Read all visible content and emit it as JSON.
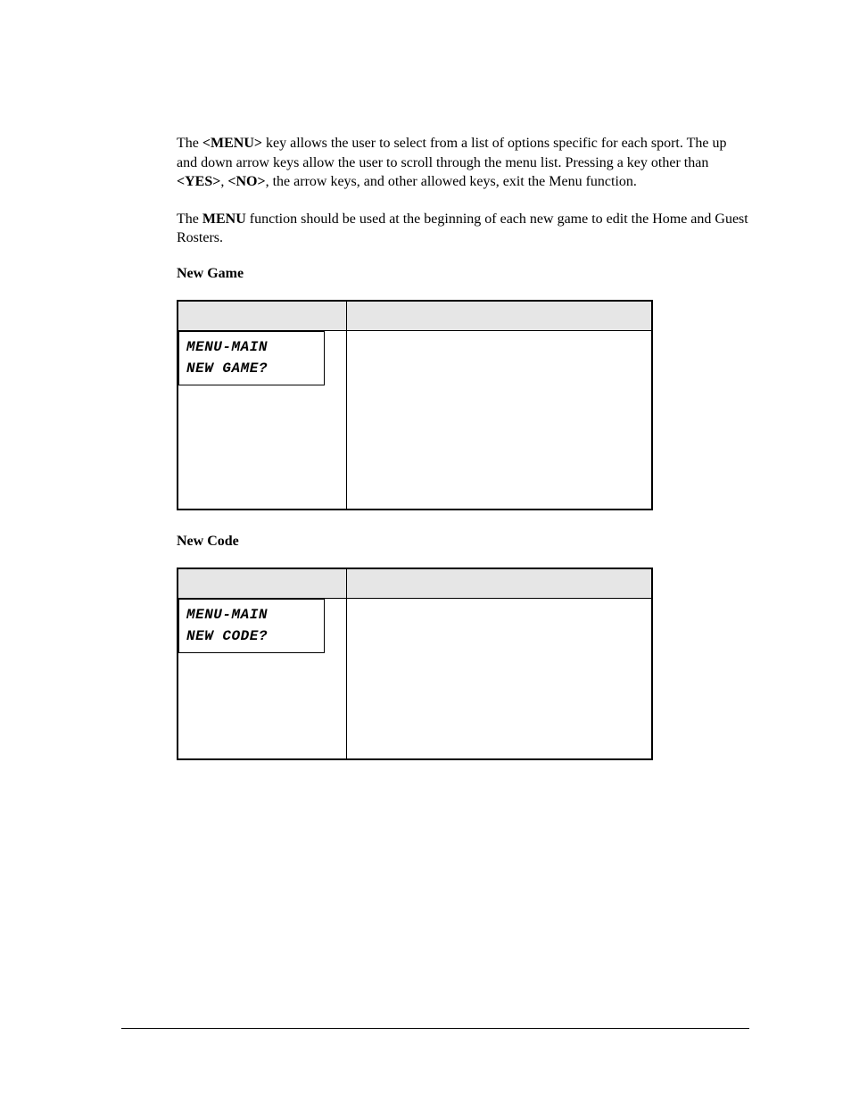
{
  "paragraph1": {
    "pre1": "The ",
    "menu_key": "<MENU>",
    "mid1": " key allows the user to select from a list of options specific for each sport.  The up and down arrow keys allow the user to scroll through the menu list.  Pressing a key other than ",
    "yes_key": "<YES>",
    "comma": ", ",
    "no_key": "<NO>",
    "post": ", the arrow keys, and other allowed keys, exit the Menu function."
  },
  "paragraph2": {
    "pre": "The ",
    "menu_bold": "MENU",
    "post": " function should be used at the beginning of each new game to edit the Home and Guest Rosters."
  },
  "sections": {
    "new_game": {
      "heading": "New Game",
      "lcd_line1": "MENU-MAIN",
      "lcd_line2": "NEW GAME?"
    },
    "new_code": {
      "heading": "New Code",
      "lcd_line1": "MENU-MAIN",
      "lcd_line2": "NEW CODE?"
    }
  }
}
